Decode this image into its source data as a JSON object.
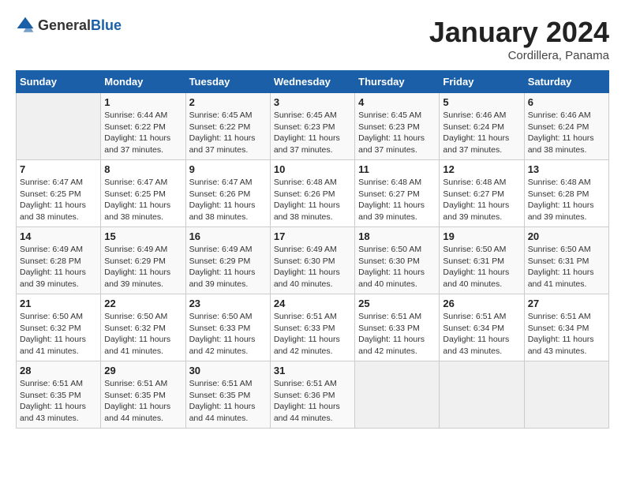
{
  "header": {
    "logo_general": "General",
    "logo_blue": "Blue",
    "title": "January 2024",
    "subtitle": "Cordillera, Panama"
  },
  "weekdays": [
    "Sunday",
    "Monday",
    "Tuesday",
    "Wednesday",
    "Thursday",
    "Friday",
    "Saturday"
  ],
  "weeks": [
    [
      {
        "day": "",
        "info": ""
      },
      {
        "day": "1",
        "info": "Sunrise: 6:44 AM\nSunset: 6:22 PM\nDaylight: 11 hours\nand 37 minutes."
      },
      {
        "day": "2",
        "info": "Sunrise: 6:45 AM\nSunset: 6:22 PM\nDaylight: 11 hours\nand 37 minutes."
      },
      {
        "day": "3",
        "info": "Sunrise: 6:45 AM\nSunset: 6:23 PM\nDaylight: 11 hours\nand 37 minutes."
      },
      {
        "day": "4",
        "info": "Sunrise: 6:45 AM\nSunset: 6:23 PM\nDaylight: 11 hours\nand 37 minutes."
      },
      {
        "day": "5",
        "info": "Sunrise: 6:46 AM\nSunset: 6:24 PM\nDaylight: 11 hours\nand 37 minutes."
      },
      {
        "day": "6",
        "info": "Sunrise: 6:46 AM\nSunset: 6:24 PM\nDaylight: 11 hours\nand 38 minutes."
      }
    ],
    [
      {
        "day": "7",
        "info": "Sunrise: 6:47 AM\nSunset: 6:25 PM\nDaylight: 11 hours\nand 38 minutes."
      },
      {
        "day": "8",
        "info": "Sunrise: 6:47 AM\nSunset: 6:25 PM\nDaylight: 11 hours\nand 38 minutes."
      },
      {
        "day": "9",
        "info": "Sunrise: 6:47 AM\nSunset: 6:26 PM\nDaylight: 11 hours\nand 38 minutes."
      },
      {
        "day": "10",
        "info": "Sunrise: 6:48 AM\nSunset: 6:26 PM\nDaylight: 11 hours\nand 38 minutes."
      },
      {
        "day": "11",
        "info": "Sunrise: 6:48 AM\nSunset: 6:27 PM\nDaylight: 11 hours\nand 39 minutes."
      },
      {
        "day": "12",
        "info": "Sunrise: 6:48 AM\nSunset: 6:27 PM\nDaylight: 11 hours\nand 39 minutes."
      },
      {
        "day": "13",
        "info": "Sunrise: 6:48 AM\nSunset: 6:28 PM\nDaylight: 11 hours\nand 39 minutes."
      }
    ],
    [
      {
        "day": "14",
        "info": "Sunrise: 6:49 AM\nSunset: 6:28 PM\nDaylight: 11 hours\nand 39 minutes."
      },
      {
        "day": "15",
        "info": "Sunrise: 6:49 AM\nSunset: 6:29 PM\nDaylight: 11 hours\nand 39 minutes."
      },
      {
        "day": "16",
        "info": "Sunrise: 6:49 AM\nSunset: 6:29 PM\nDaylight: 11 hours\nand 39 minutes."
      },
      {
        "day": "17",
        "info": "Sunrise: 6:49 AM\nSunset: 6:30 PM\nDaylight: 11 hours\nand 40 minutes."
      },
      {
        "day": "18",
        "info": "Sunrise: 6:50 AM\nSunset: 6:30 PM\nDaylight: 11 hours\nand 40 minutes."
      },
      {
        "day": "19",
        "info": "Sunrise: 6:50 AM\nSunset: 6:31 PM\nDaylight: 11 hours\nand 40 minutes."
      },
      {
        "day": "20",
        "info": "Sunrise: 6:50 AM\nSunset: 6:31 PM\nDaylight: 11 hours\nand 41 minutes."
      }
    ],
    [
      {
        "day": "21",
        "info": "Sunrise: 6:50 AM\nSunset: 6:32 PM\nDaylight: 11 hours\nand 41 minutes."
      },
      {
        "day": "22",
        "info": "Sunrise: 6:50 AM\nSunset: 6:32 PM\nDaylight: 11 hours\nand 41 minutes."
      },
      {
        "day": "23",
        "info": "Sunrise: 6:50 AM\nSunset: 6:33 PM\nDaylight: 11 hours\nand 42 minutes."
      },
      {
        "day": "24",
        "info": "Sunrise: 6:51 AM\nSunset: 6:33 PM\nDaylight: 11 hours\nand 42 minutes."
      },
      {
        "day": "25",
        "info": "Sunrise: 6:51 AM\nSunset: 6:33 PM\nDaylight: 11 hours\nand 42 minutes."
      },
      {
        "day": "26",
        "info": "Sunrise: 6:51 AM\nSunset: 6:34 PM\nDaylight: 11 hours\nand 43 minutes."
      },
      {
        "day": "27",
        "info": "Sunrise: 6:51 AM\nSunset: 6:34 PM\nDaylight: 11 hours\nand 43 minutes."
      }
    ],
    [
      {
        "day": "28",
        "info": "Sunrise: 6:51 AM\nSunset: 6:35 PM\nDaylight: 11 hours\nand 43 minutes."
      },
      {
        "day": "29",
        "info": "Sunrise: 6:51 AM\nSunset: 6:35 PM\nDaylight: 11 hours\nand 44 minutes."
      },
      {
        "day": "30",
        "info": "Sunrise: 6:51 AM\nSunset: 6:35 PM\nDaylight: 11 hours\nand 44 minutes."
      },
      {
        "day": "31",
        "info": "Sunrise: 6:51 AM\nSunset: 6:36 PM\nDaylight: 11 hours\nand 44 minutes."
      },
      {
        "day": "",
        "info": ""
      },
      {
        "day": "",
        "info": ""
      },
      {
        "day": "",
        "info": ""
      }
    ]
  ]
}
